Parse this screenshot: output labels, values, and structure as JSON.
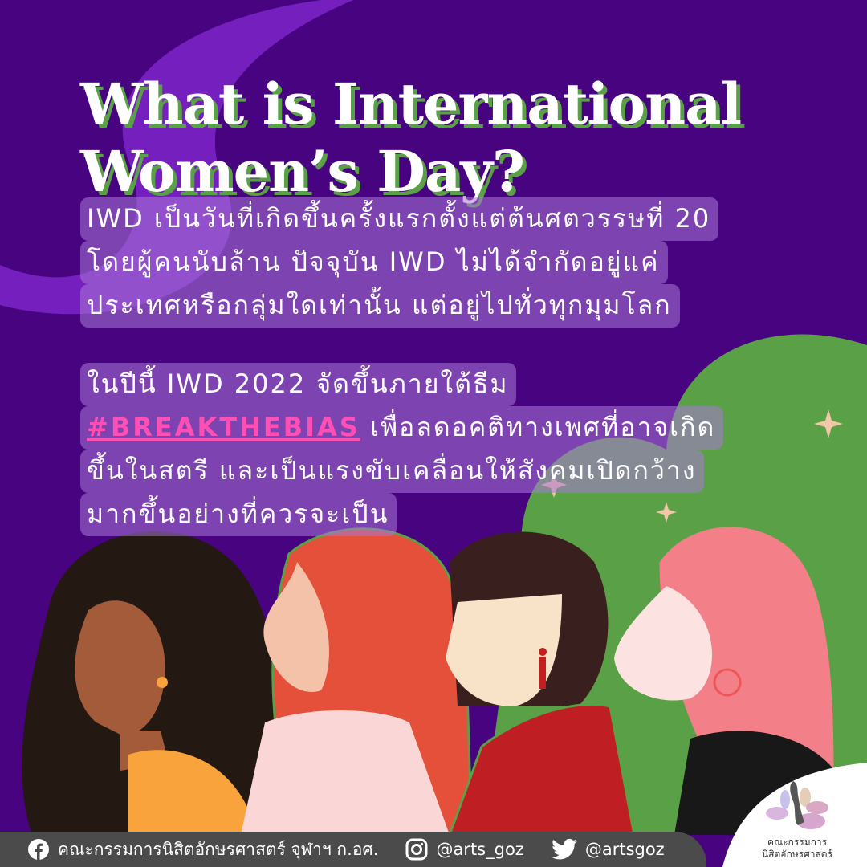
{
  "title": {
    "line1": "What is International",
    "line2": "Women’s Day?"
  },
  "paragraph1": [
    "IWD เป็นวันที่เกิดขึ้นครั้งแรกตั้งแต่ต้นศตวรรษที่ 20",
    "โดยผู้คนนับล้าน ปัจจุบัน IWD ไม่ได้จำกัดอยู่แค่",
    "ประเทศหรือกลุ่มใดเท่านั้น แต่อยู่ไปทั่วทุกมุมโลก"
  ],
  "paragraph2": {
    "line1": "ในปีนี้ IWD 2022 จัดขึ้นภายใต้ธีม",
    "hashtag": "#BREAKTHEBIAS",
    "line2_rest": " เพื่อลดอคติทางเพศที่อาจเกิด",
    "line3": "ขึ้นในสตรี และเป็นแรงขับเคลื่อนให้สังคมเปิดกว้าง",
    "line4": "มากขึ้นอย่างที่ควรจะเป็น"
  },
  "footer": {
    "facebook": "คณะกรรมการนิสิตอักษรศาสตร์ จุฬาฯ ก.อศ.",
    "instagram": "@arts_goz",
    "twitter": "@artsgoz"
  },
  "logo": {
    "line1": "คณะกรรมการ",
    "line2": "นิสิตอักษรศาสตร์"
  },
  "colors": {
    "background": "#480380",
    "accent_green": "#5aa046",
    "hashtag": "#ff4fb4"
  }
}
